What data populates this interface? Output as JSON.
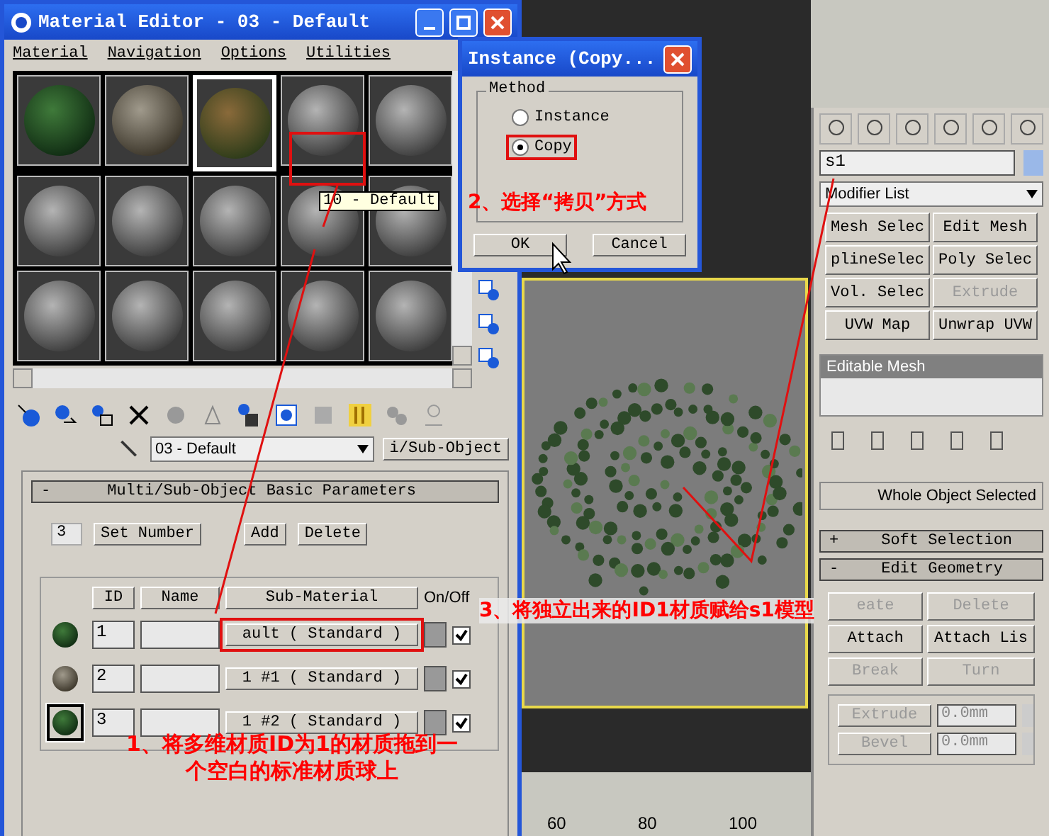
{
  "material_editor": {
    "title": "Material Editor - 03 - Default",
    "menu": [
      "Material",
      "Navigation",
      "Options",
      "Utilities"
    ],
    "slots": [
      {
        "kind": "foliage",
        "selected": false
      },
      {
        "kind": "rock",
        "selected": false
      },
      {
        "kind": "mixed",
        "selected": true
      },
      {
        "kind": "plain",
        "selected": false
      },
      {
        "kind": "plain",
        "selected": false
      },
      {
        "kind": "plain",
        "selected": false
      },
      {
        "kind": "plain",
        "selected": false
      },
      {
        "kind": "plain",
        "selected": false
      },
      {
        "kind": "plain",
        "selected": false
      },
      {
        "kind": "plain",
        "selected": false
      },
      {
        "kind": "plain",
        "selected": false
      },
      {
        "kind": "plain",
        "selected": false
      },
      {
        "kind": "plain",
        "selected": false
      },
      {
        "kind": "plain",
        "selected": false
      },
      {
        "kind": "plain",
        "selected": false
      }
    ],
    "tooltip": "10 - Default",
    "material_name": "03 - Default",
    "type_button": "i/Sub-Object",
    "rollout": {
      "sign": "-",
      "title": "Multi/Sub-Object Basic Parameters"
    },
    "count": "3",
    "buttons": [
      "Set Number",
      "Add",
      "Delete"
    ],
    "columns": [
      "ID",
      "Name",
      "Sub-Material",
      "On/Off"
    ],
    "rows": [
      {
        "kind": "foliage",
        "selected": false,
        "id": "1",
        "sub_material": "ault  ( Standard )",
        "highlighted": true,
        "on": true
      },
      {
        "kind": "rock",
        "selected": false,
        "id": "2",
        "sub_material": "1 #1  ( Standard )",
        "highlighted": false,
        "on": true
      },
      {
        "kind": "foliage",
        "selected": true,
        "id": "3",
        "sub_material": "1 #2  ( Standard )",
        "highlighted": false,
        "on": true
      }
    ]
  },
  "dialog": {
    "title": "Instance (Copy...",
    "group": "Method",
    "options": [
      {
        "label": "Instance",
        "selected": false,
        "highlighted": false
      },
      {
        "label": "Copy",
        "selected": true,
        "highlighted": true
      }
    ],
    "buttons": [
      "OK",
      "Cancel"
    ]
  },
  "command_panel": {
    "object_name": "s1",
    "modifier_list": "Modifier List",
    "modifiers": [
      {
        "label": "Mesh Selec",
        "disabled": false
      },
      {
        "label": "Edit Mesh",
        "disabled": false
      },
      {
        "label": "plineSelec",
        "disabled": false
      },
      {
        "label": "Poly Selec",
        "disabled": false
      },
      {
        "label": "Vol. Selec",
        "disabled": false
      },
      {
        "label": "Extrude",
        "disabled": true
      },
      {
        "label": "UVW Map",
        "disabled": false
      },
      {
        "label": "Unwrap UVW",
        "disabled": false
      }
    ],
    "stack_item": "Editable Mesh",
    "selection_status": "Whole Object Selected",
    "rollouts": [
      {
        "sign": "+",
        "title": "Soft Selection"
      },
      {
        "sign": "-",
        "title": "Edit Geometry"
      }
    ],
    "geometry_buttons": [
      {
        "label": "eate",
        "disabled": true
      },
      {
        "label": "Delete",
        "disabled": true
      },
      {
        "label": "Attach",
        "disabled": false
      },
      {
        "label": "Attach Lis",
        "disabled": false
      },
      {
        "label": "Break",
        "disabled": true
      },
      {
        "label": "Turn",
        "disabled": true
      }
    ],
    "spinners": [
      {
        "label": "Extrude",
        "value": "0.0mm",
        "disabled": true
      },
      {
        "label": "Bevel",
        "value": "0.0mm",
        "disabled": true
      }
    ]
  },
  "viewport": {
    "ruler_labels": [
      "60",
      "80",
      "100"
    ]
  },
  "annotations": [
    "2、选择“拷贝”方式",
    "1、将多维材质ID为1的材质拖到一个空白的标准材质球上",
    "3、将独立出来的ID1材质赋给s1模型"
  ]
}
